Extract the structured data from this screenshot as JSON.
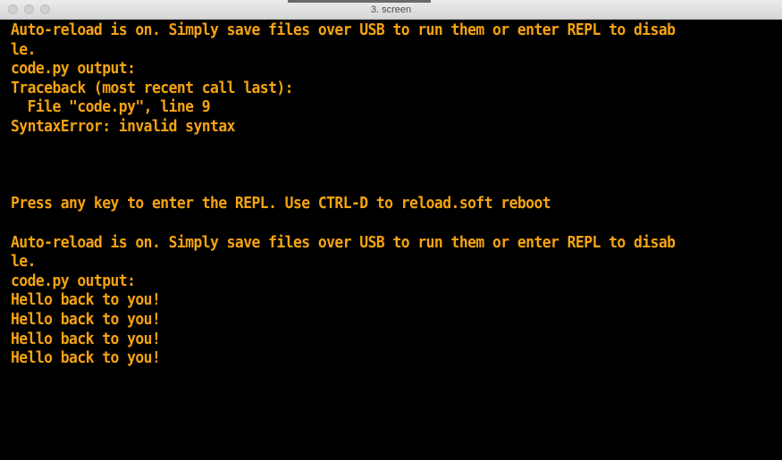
{
  "window": {
    "title": "3. screen"
  },
  "terminal": {
    "lines": [
      "Auto-reload is on. Simply save files over USB to run them or enter REPL to disab",
      "le.",
      "code.py output:",
      "Traceback (most recent call last):",
      "  File \"code.py\", line 9",
      "SyntaxError: invalid syntax",
      "",
      "",
      "",
      "Press any key to enter the REPL. Use CTRL-D to reload.soft reboot",
      "",
      "Auto-reload is on. Simply save files over USB to run them or enter REPL to disab",
      "le.",
      "code.py output:",
      "Hello back to you!",
      "Hello back to you!",
      "Hello back to you!",
      "Hello back to you!"
    ]
  },
  "colors": {
    "terminal_background": "#000000",
    "terminal_text": "#f5a311",
    "titlebar": "#e0e0e0"
  }
}
